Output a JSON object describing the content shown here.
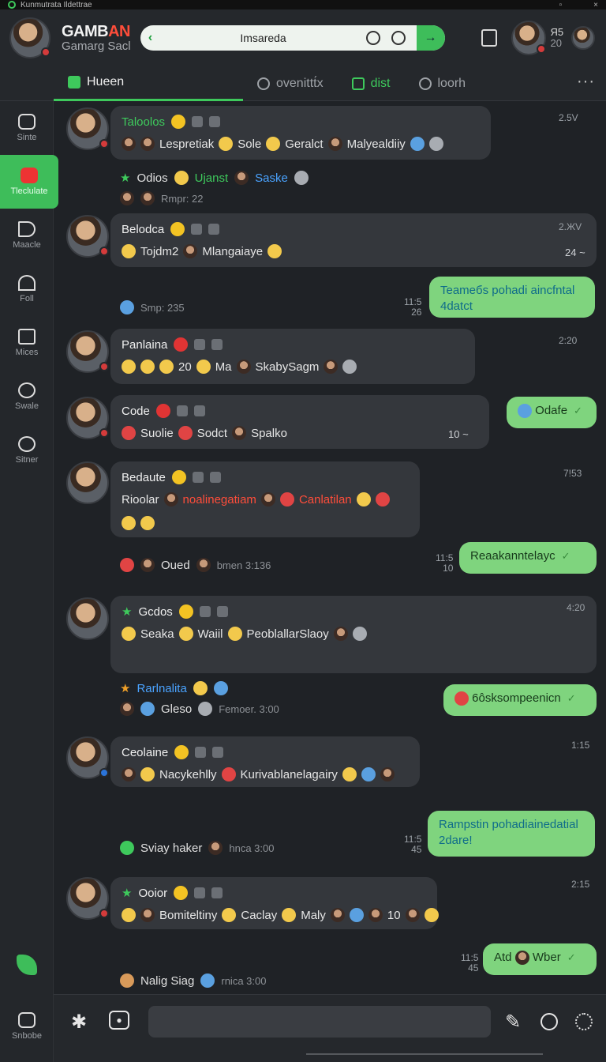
{
  "os": {
    "title": "Kunmutrata Ildettrae",
    "right": [
      "",
      "×"
    ]
  },
  "header": {
    "brand_title_a": "GAMB",
    "brand_title_b": "AN",
    "brand_subtitle": "Gamarg Sacl",
    "search_value": "Imsareda",
    "count_a": "Я5",
    "count_b": "20"
  },
  "tabs": [
    {
      "label": "Hueen"
    },
    {
      "label": "ovenittt́x"
    },
    {
      "label": "dist"
    },
    {
      "label": "loorh"
    }
  ],
  "sidebar": [
    {
      "label": "Sinte"
    },
    {
      "label": "Tleclulate"
    },
    {
      "label": "Maacle"
    },
    {
      "label": "Foll"
    },
    {
      "label": "Mices"
    },
    {
      "label": "Swale"
    },
    {
      "label": "Sitner"
    }
  ],
  "sidebar_bottom": {
    "label": "Snbobe"
  },
  "messages": [
    {
      "name": "Taloolos",
      "text_a": "Lespretiak",
      "text_b": "Sole",
      "text_c": "Geralct",
      "text_d": "Malyealdiiy",
      "time": "2.5V"
    },
    {
      "name": "Odios",
      "tag": "Ujanst",
      "tag2": "Saske",
      "sub": "Rmpr: 22"
    },
    {
      "name": "Belodca",
      "text_a": "Tojdm2",
      "text_b": "Mlangaiaye",
      "time": "2.ЖV",
      "count": "24 ~"
    },
    {
      "name": "Panlaina",
      "text_a": "20",
      "text_b": "Ma",
      "text_c": "SkabySagm",
      "time": "2:20"
    },
    {
      "name": "Code",
      "text_a": "Suolie",
      "text_b": "Sodct",
      "text_c": "Spalko",
      "count": "10 ~"
    },
    {
      "name": "Bedaute",
      "text_a": "Rioolar",
      "text_b": "noalinegatiam",
      "text_c": "Canlatilan",
      "time": "7!53"
    },
    {
      "name": "Gcdos",
      "text_a": "Seaka",
      "text_b": "Waiil",
      "text_c": "PeoblallarSlaoy",
      "time": "4:20"
    },
    {
      "name": "Ceolaine",
      "text_a": "Nacykehlly",
      "text_b": "Kurivablanelagairy",
      "time": "1:15"
    },
    {
      "name": "Ooior",
      "text_a": "Bomiteltiny",
      "text_b": "Caclay",
      "text_c": "Maly",
      "text_d": "10",
      "time": "2:15"
    }
  ],
  "sublines": [
    {
      "text": "Smp: 235"
    },
    {
      "text": "Oued",
      "muted": "bmen 3:136"
    },
    {
      "text": "Rarlnalita"
    },
    {
      "text": "Gleso",
      "muted": "Femoer. 3:00"
    },
    {
      "text": "Sviay haker",
      "muted": "hnca 3:00"
    },
    {
      "text": "Nalig Siag",
      "muted": "rnica 3:00"
    }
  ],
  "outgoing": [
    {
      "text": "Teameбs pohadi aincfntal 4datct",
      "stamp_a": "11:5",
      "stamp_b": "26"
    },
    {
      "text": "Odafe"
    },
    {
      "text": "Reaakanntelayc",
      "stamp_a": "11:5",
      "stamp_b": "10"
    },
    {
      "text": "6ôsksompeenicn"
    },
    {
      "text": "Rampstin pohadiainedatial 2dare!",
      "stamp_a": "11:5",
      "stamp_b": "45"
    },
    {
      "text": "Atd",
      "text_b": "Wber",
      "stamp_a": "11:5",
      "stamp_b": "45"
    }
  ],
  "composer": {
    "placeholder": ""
  },
  "colors": {
    "accent": "#3ec95c",
    "bubble_in": "#34373c",
    "bubble_out": "#7fd47e",
    "bg": "#1f2226"
  }
}
